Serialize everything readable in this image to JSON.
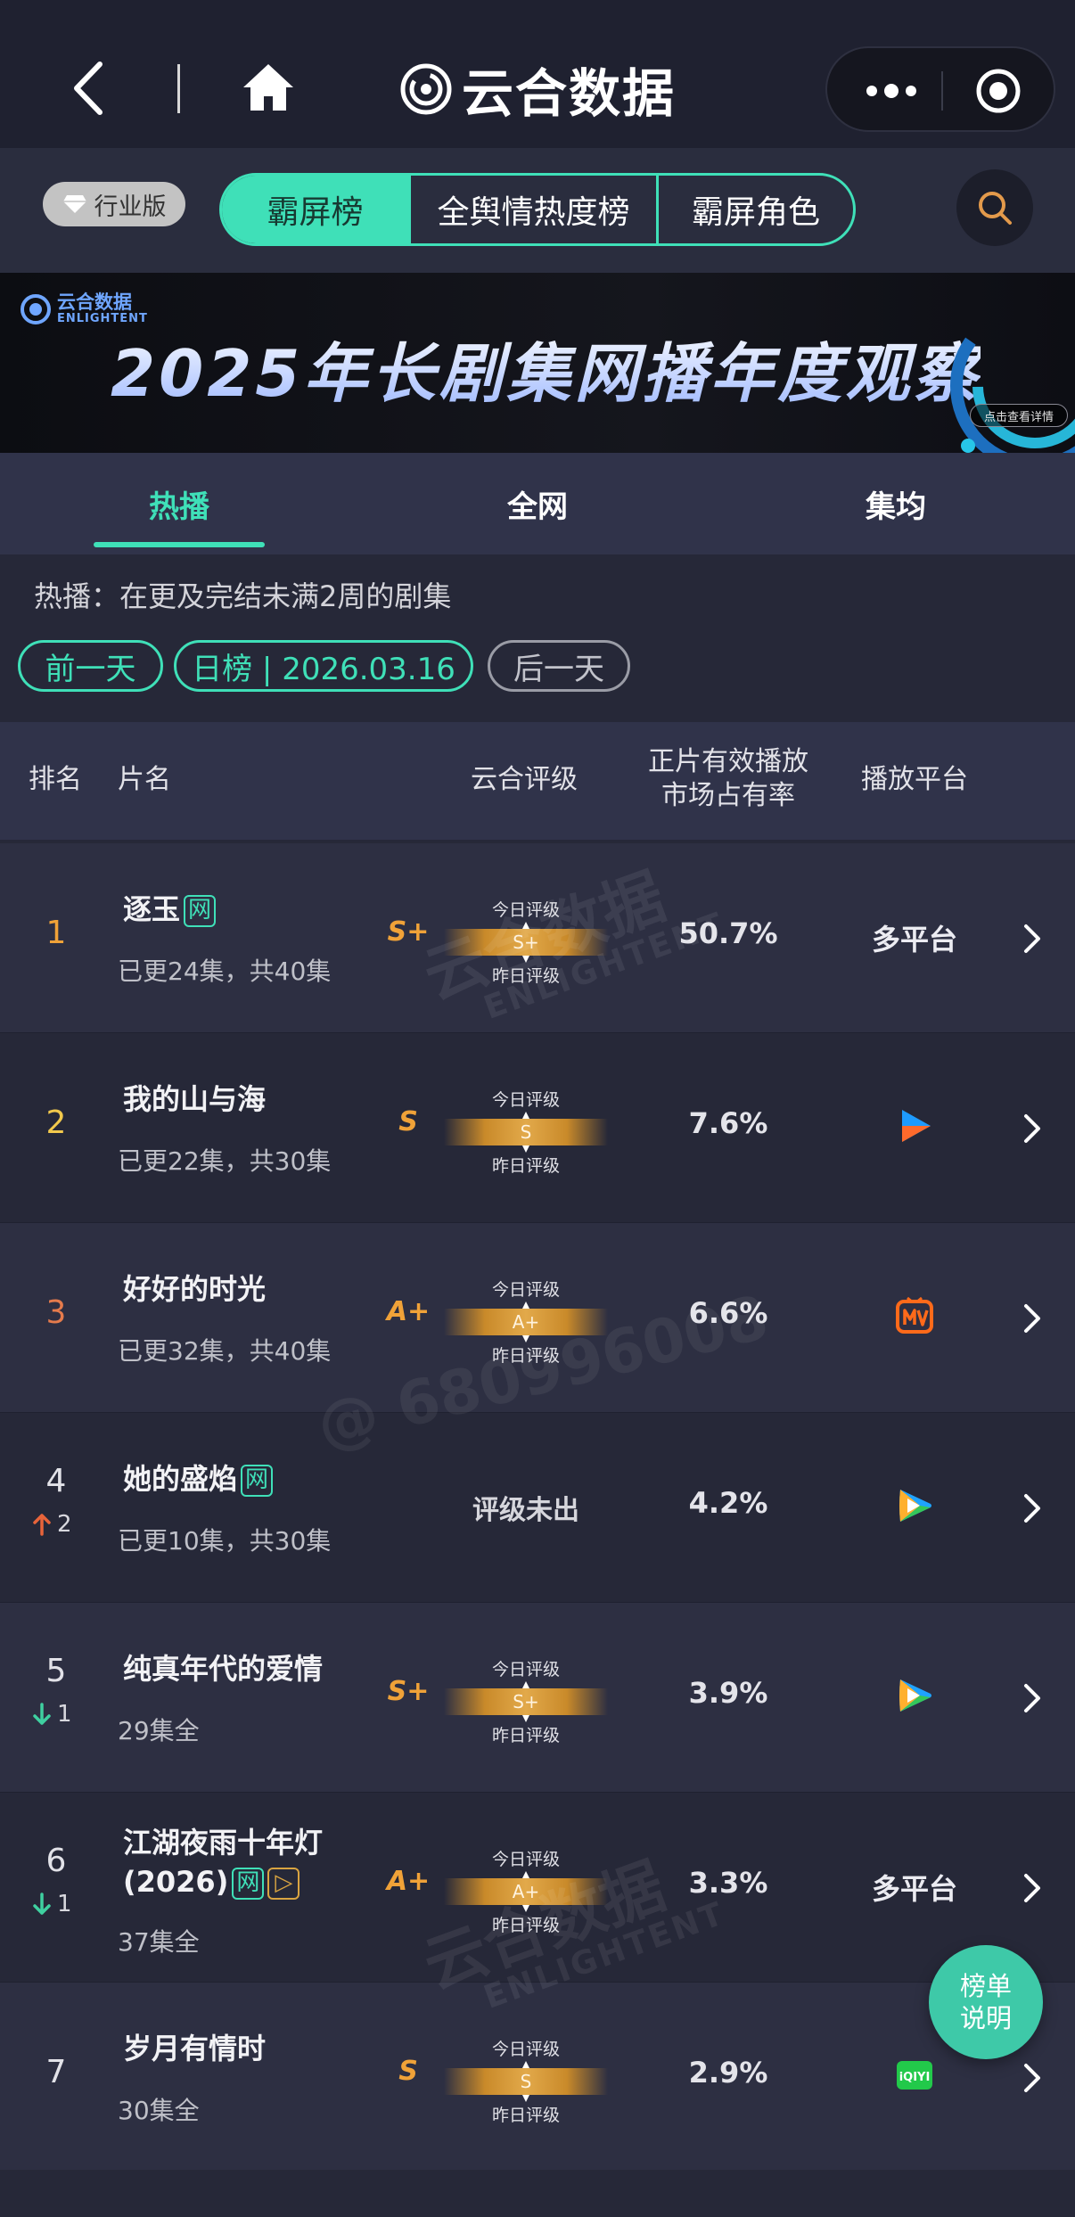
{
  "app": {
    "title": "云合数据",
    "colors": {
      "accent": "#3fe0b8",
      "grade": "#f0a238",
      "background": "#262838"
    }
  },
  "topbar": {
    "back_icon": "chevron-left-icon",
    "home_icon": "home-icon",
    "menu_icon": "more-dots-icon",
    "close_icon": "target-circle-icon"
  },
  "filters": {
    "edition": "行业版",
    "segments": [
      "霸屏榜",
      "全舆情热度榜",
      "霸屏角色"
    ],
    "active_segment": "霸屏榜",
    "search_icon": "search-icon"
  },
  "banner": {
    "logo_text": "云合数据",
    "logo_sub": "ENLIGHTENT",
    "title": "2025年长剧集网播年度观察",
    "cta": "点击查看详情"
  },
  "tabs": {
    "items": [
      "热播",
      "全网",
      "集均"
    ],
    "active": "热播"
  },
  "info": {
    "description": "热播：在更及完结未满2周的剧集",
    "prev_day": "前一天",
    "current_date": "日榜 | 2026.03.16",
    "next_day": "后一天"
  },
  "table": {
    "headers": {
      "rank": "排名",
      "name": "片名",
      "rating": "云合评级",
      "share_line1": "正片有效播放",
      "share_line2": "市场占有率",
      "platform": "播放平台"
    },
    "grade_today_label": "今日评级",
    "grade_yesterday_label": "昨日评级",
    "rows": [
      {
        "rank": "1",
        "rank_color": "#f0a238",
        "trend": "",
        "trend_dir": "",
        "title": "逐玉",
        "tags": [
          "网"
        ],
        "episodes": "已更24集，共40集",
        "grade": "S+",
        "grade_today": "S+",
        "share": "50.7%",
        "platform": "多平台",
        "platform_icon": ""
      },
      {
        "rank": "2",
        "rank_color": "#f2c94c",
        "trend": "",
        "trend_dir": "",
        "title": "我的山与海",
        "tags": [],
        "episodes": "已更22集，共30集",
        "grade": "S",
        "grade_today": "S",
        "share": "7.6%",
        "platform": "",
        "platform_icon": "youku-play-icon"
      },
      {
        "rank": "3",
        "rank_color": "#e57b4c",
        "trend": "",
        "trend_dir": "",
        "title": "好好的时光",
        "tags": [],
        "episodes": "已更32集，共40集",
        "grade": "A+",
        "grade_today": "A+",
        "share": "6.6%",
        "platform": "",
        "platform_icon": "mango-tv-icon"
      },
      {
        "rank": "4",
        "rank_color": "#e2e2e8",
        "trend": "2",
        "trend_dir": "up",
        "title": "她的盛焰",
        "tags": [
          "网"
        ],
        "episodes": "已更10集，共30集",
        "grade": "",
        "grade_none": "评级未出",
        "grade_today": "",
        "share": "4.2%",
        "platform": "",
        "platform_icon": "tencent-video-icon"
      },
      {
        "rank": "5",
        "rank_color": "#e2e2e8",
        "trend": "1",
        "trend_dir": "down",
        "title": "纯真年代的爱情",
        "tags": [],
        "episodes": "29集全",
        "grade": "S+",
        "grade_today": "S+",
        "share": "3.9%",
        "platform": "",
        "platform_icon": "tencent-video-icon"
      },
      {
        "rank": "6",
        "rank_color": "#e2e2e8",
        "trend": "1",
        "trend_dir": "down",
        "title": "江湖夜雨十年灯(2026)",
        "tags": [
          "网",
          "▷"
        ],
        "episodes": "37集全",
        "grade": "A+",
        "grade_today": "A+",
        "share": "3.3%",
        "platform": "多平台",
        "platform_icon": ""
      },
      {
        "rank": "7",
        "rank_color": "#e2e2e8",
        "trend": "",
        "trend_dir": "",
        "title": "岁月有情时",
        "tags": [],
        "episodes": "30集全",
        "grade": "S",
        "grade_today": "S",
        "share": "2.9%",
        "platform": "",
        "platform_icon": "iqiyi-icon"
      }
    ]
  },
  "watermark": {
    "brand": "云合数据",
    "brand_en": "ENLIGHTENT",
    "user_id": "@ 680996008"
  },
  "float_button": {
    "line1": "榜单",
    "line2": "说明"
  }
}
